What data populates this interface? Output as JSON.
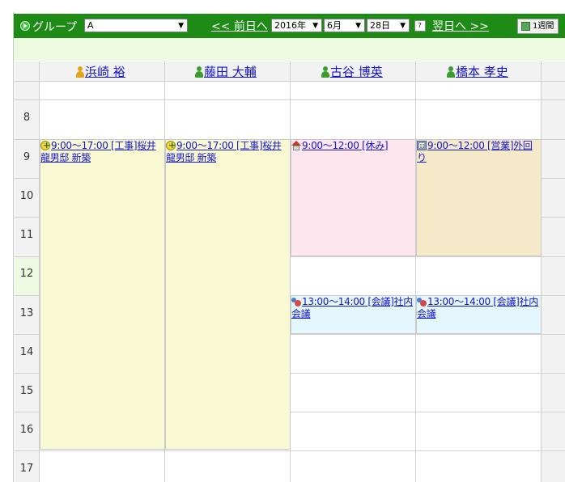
{
  "toolbar": {
    "group_label": "グループ",
    "group_value": "A",
    "prev_day": "<< 前日へ",
    "year": "2016年",
    "month": "6月",
    "day": "28日",
    "calendar_icon_char": "7",
    "next_day": "翌日へ >>",
    "week_button": "1週間"
  },
  "members": [
    {
      "name": "浜崎 裕",
      "icon": "user-icon-yellow"
    },
    {
      "name": "藤田 大輔",
      "icon": "user-icon-green"
    },
    {
      "name": "古谷 博英",
      "icon": "user-icon-green"
    },
    {
      "name": "橋本 孝史",
      "icon": "user-icon-green"
    }
  ],
  "hours": [
    "8",
    "9",
    "10",
    "11",
    "12",
    "13",
    "14",
    "15",
    "16",
    "17"
  ],
  "events": [
    {
      "member": 0,
      "icon": "construction-icon",
      "text": "9:00～17:00 [工事]桜井龍男邸 新築",
      "color": "#f9f9d4"
    },
    {
      "member": 1,
      "icon": "construction-icon",
      "text": "9:00～17:00 [工事]桜井龍男邸 新築",
      "color": "#f9f9d4"
    },
    {
      "member": 2,
      "icon": "home-icon",
      "text": "9:00～12:00 [休み]",
      "color": "#fde6ee"
    },
    {
      "member": 3,
      "icon": "building-icon",
      "text": "9:00～12:00 [営業]外回り",
      "color": "#f5e9c9"
    },
    {
      "member": 2,
      "icon": "meeting-icon",
      "text": "13:00～14:00 [会議]社内会議",
      "color": "#e4f7fd"
    },
    {
      "member": 3,
      "icon": "meeting-icon",
      "text": "13:00～14:00 [会議]社内会議",
      "color": "#e4f7fd"
    }
  ],
  "colors": {
    "toolbar_bg": "#1d8b16",
    "subbar_bg": "#edfadf",
    "link": "#1515cc"
  }
}
